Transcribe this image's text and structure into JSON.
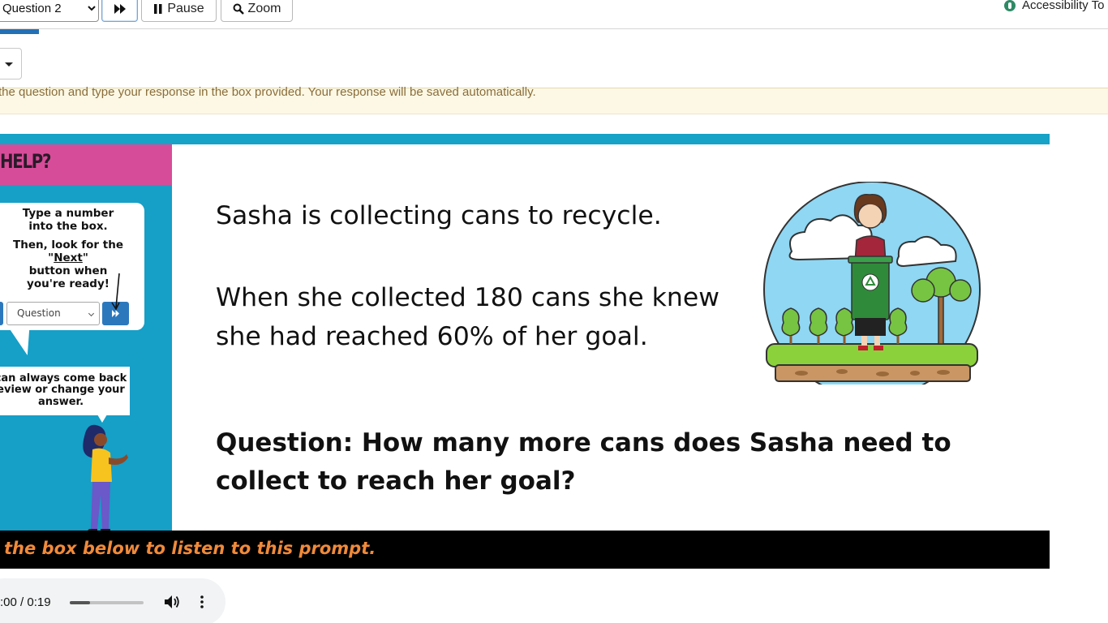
{
  "toolbar": {
    "question_select_value": "Question 2",
    "pause_label": "Pause",
    "zoom_label": "Zoom",
    "accessibility_label": "Accessibility To"
  },
  "notice": {
    "text": "the question and type your response in the box provided. Your response will be saved automatically."
  },
  "help_panel": {
    "title": "HELP?",
    "bubble1_line1a": "Type a number",
    "bubble1_line1b": "into the box.",
    "bubble1_line2a": "Then, look for the \"",
    "bubble1_line2_link": "Next",
    "bubble1_line2b": "\"",
    "bubble1_line3": "button when",
    "bubble1_line4": "you're ready!",
    "mini_select_value": "Question",
    "bubble2_line1": "can always come back",
    "bubble2_line2": "eview or change your",
    "bubble2_line3": "answer."
  },
  "prompt": {
    "line1": "Sasha is collecting cans to recycle.",
    "line2a": "When she collected 180 cans she knew",
    "line2b": "she had reached 60% of her goal.",
    "question_a": "Question: How many more cans does Sasha need to",
    "question_b": "collect to reach her goal?"
  },
  "bottom_bar": {
    "text": " the box below to listen to this prompt."
  },
  "audio": {
    "time": ":00 / 0:19",
    "progress_fraction": 0.28
  },
  "colors": {
    "stripe_blue": "#17a2c7",
    "help_pink": "#d74c98",
    "toolbar_accent": "#2470b5",
    "notice_bg": "#fcf8e5",
    "notice_text": "#8a6d3b",
    "prompt_orange": "#f08a3a"
  },
  "icons": {
    "next": "fast-forward-icon",
    "pause": "pause-icon",
    "zoom": "magnifier-icon",
    "accessibility": "accessibility-icon",
    "audio_volume": "volume-icon",
    "audio_more": "more-vertical-icon"
  }
}
